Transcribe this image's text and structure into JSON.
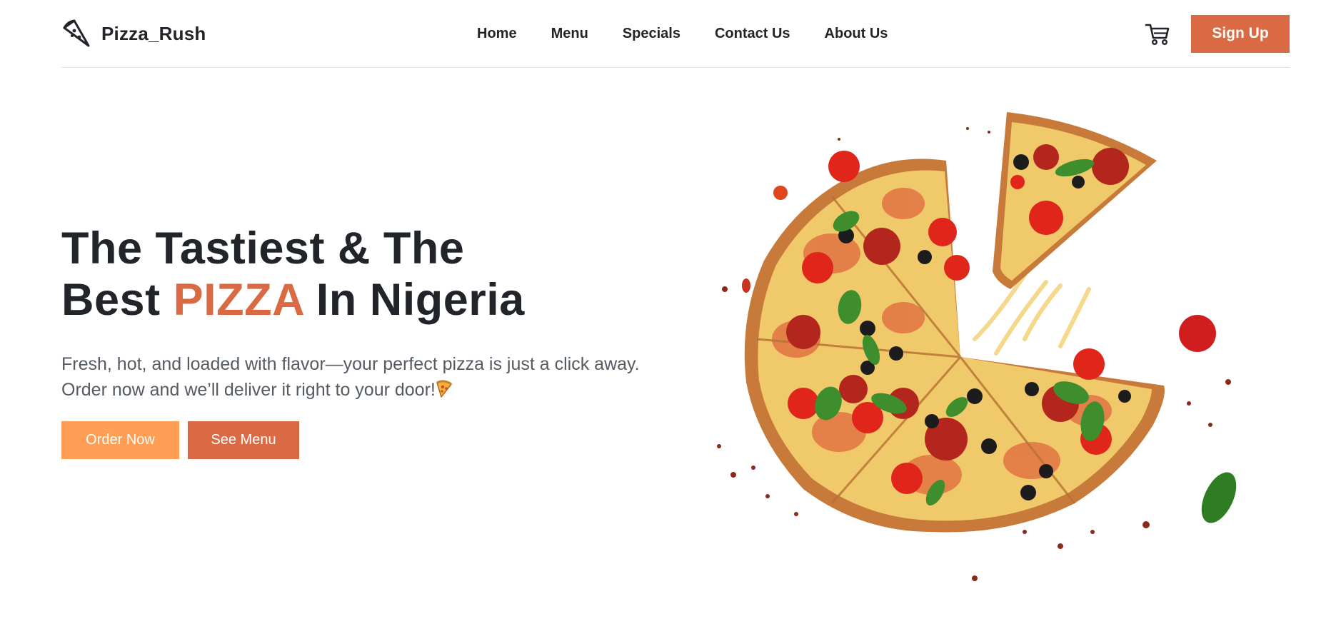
{
  "brand": {
    "name": "Pizza_Rush",
    "icon": "pizza-slice-icon"
  },
  "nav": {
    "links": [
      "Home",
      "Menu",
      "Specials",
      "Contact Us",
      "About Us"
    ],
    "cart_icon": "cart-icon",
    "signup_label": "Sign Up"
  },
  "hero": {
    "title_line1": "The Tastiest & The",
    "title_best": "Best",
    "title_accent": "PIZZA",
    "title_end": "In Nigeria",
    "description": "Fresh, hot, and loaded with flavor—your perfect pizza is just a click away. Order now and we’ll deliver it right to your door!",
    "description_emoji": "pizza-slice-emoji",
    "order_label": "Order Now",
    "menu_label": "See Menu",
    "image": "sliced-pizza-image"
  },
  "colors": {
    "accent": "#d96a44",
    "order_button": "#ff9e54",
    "text_dark": "#212529",
    "text_muted": "#555b63",
    "divider": "#dee2e6"
  }
}
